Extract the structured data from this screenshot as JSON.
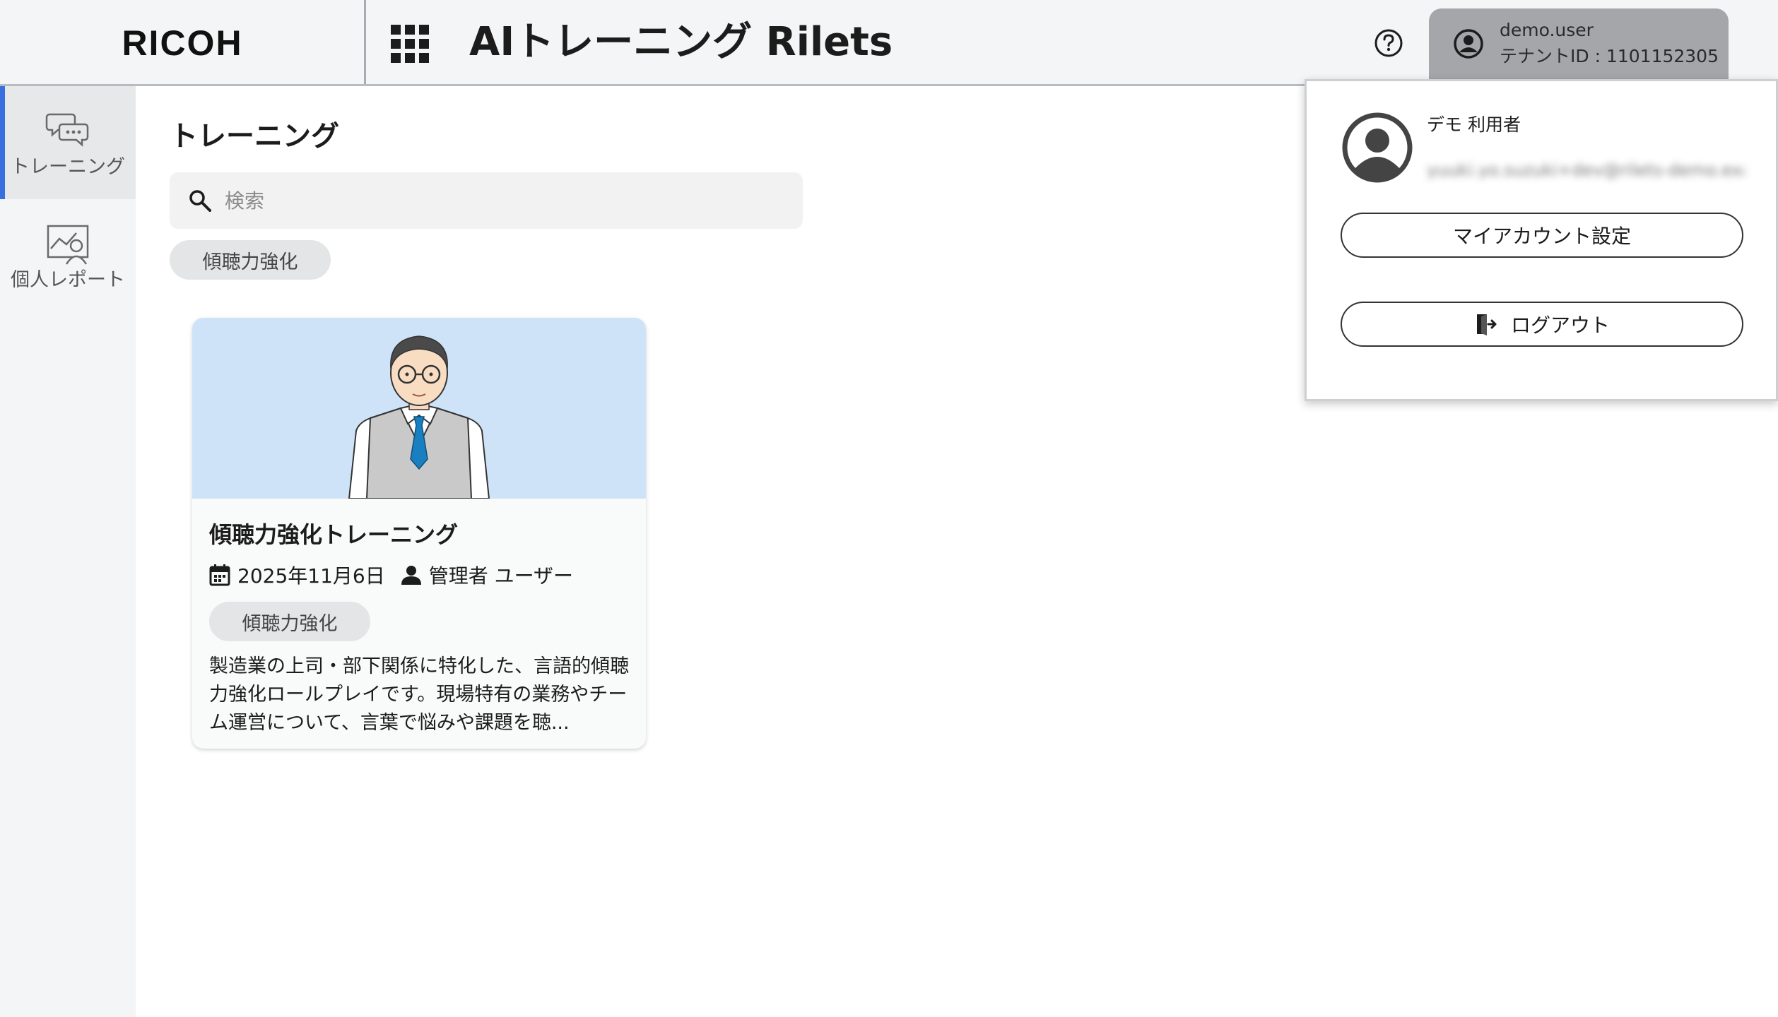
{
  "header": {
    "logo_text": "RICOH",
    "app_title": "AIトレーニング Rilets",
    "user": {
      "username": "demo.user",
      "tenant": "テナントID : 1101152305"
    }
  },
  "sidebar": {
    "items": [
      {
        "label": "トレーニング",
        "icon": "chat-bubbles-icon",
        "active": true
      },
      {
        "label": "個人レポート",
        "icon": "report-chart-icon",
        "active": false
      }
    ]
  },
  "main": {
    "page_title": "トレーニング",
    "search": {
      "placeholder": "検索",
      "value": ""
    },
    "filter_tags": [
      "傾聴力強化"
    ],
    "cards": [
      {
        "title": "傾聴力強化トレーニング",
        "date": "2025年11月6日",
        "author": "管理者 ユーザー",
        "tag": "傾聴力強化",
        "description": "製造業の上司・部下関係に特化した、言語的傾聴力強化ロールプレイです。現場特有の業務やチーム運営について、言葉で悩みや課題を聴..."
      }
    ]
  },
  "user_menu": {
    "display_name": "デモ 利用者",
    "email": "yuuki.yo.suzuki+dev@rilets-demo.example",
    "account_settings_label": "マイアカウント設定",
    "logout_label": "ログアウト"
  },
  "colors": {
    "accent": "#3a6fe0",
    "header_bg": "#f4f5f6",
    "user_button_bg": "#a4a6a9",
    "card_image_bg": "#cfe3f8"
  }
}
